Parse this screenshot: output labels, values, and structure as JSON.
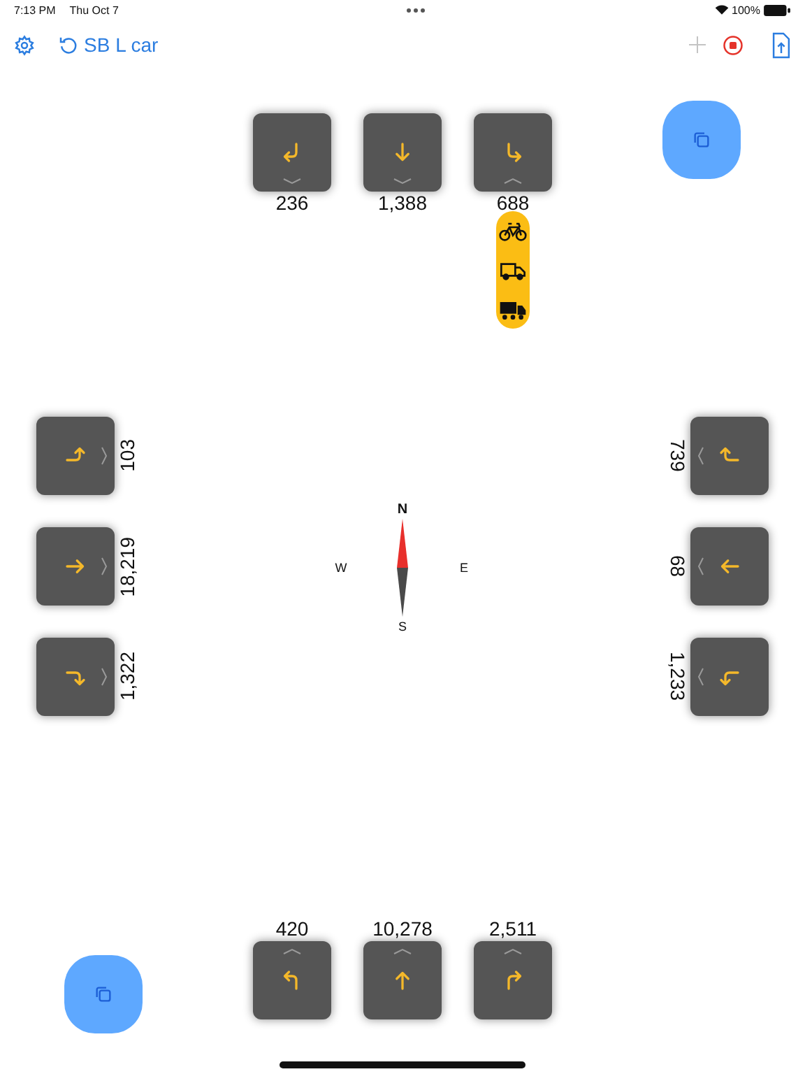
{
  "status_bar": {
    "time": "7:13 PM",
    "date": "Thu Oct 7",
    "battery": "100%"
  },
  "toolbar": {
    "title": "SB L car",
    "add_disabled": true
  },
  "approaches": [
    {
      "kind": "north",
      "movements": [
        {
          "kind": "right",
          "count": "236",
          "expanded": false
        },
        {
          "kind": "through",
          "count": "1,388",
          "expanded": false
        },
        {
          "kind": "left",
          "count": "688",
          "expanded": true,
          "vehicles": [
            {
              "kind": "bicycle"
            },
            {
              "kind": "van"
            },
            {
              "kind": "truck"
            }
          ]
        }
      ]
    },
    {
      "kind": "west",
      "movements": [
        {
          "kind": "left",
          "count": "103",
          "expanded": false
        },
        {
          "kind": "through",
          "count": "18,219",
          "expanded": false
        },
        {
          "kind": "right",
          "count": "1,322",
          "expanded": false
        }
      ]
    },
    {
      "kind": "east",
      "movements": [
        {
          "kind": "right",
          "count": "739",
          "expanded": false
        },
        {
          "kind": "through",
          "count": "68",
          "expanded": false
        },
        {
          "kind": "left",
          "count": "1,233",
          "expanded": false
        }
      ]
    },
    {
      "kind": "south",
      "movements": [
        {
          "kind": "left",
          "count": "420",
          "expanded": false
        },
        {
          "kind": "through",
          "count": "10,278",
          "expanded": false
        },
        {
          "kind": "right",
          "count": "2,511",
          "expanded": false
        }
      ]
    }
  ],
  "compass": {
    "north": "N",
    "west": "W",
    "east": "E",
    "south": "S"
  }
}
